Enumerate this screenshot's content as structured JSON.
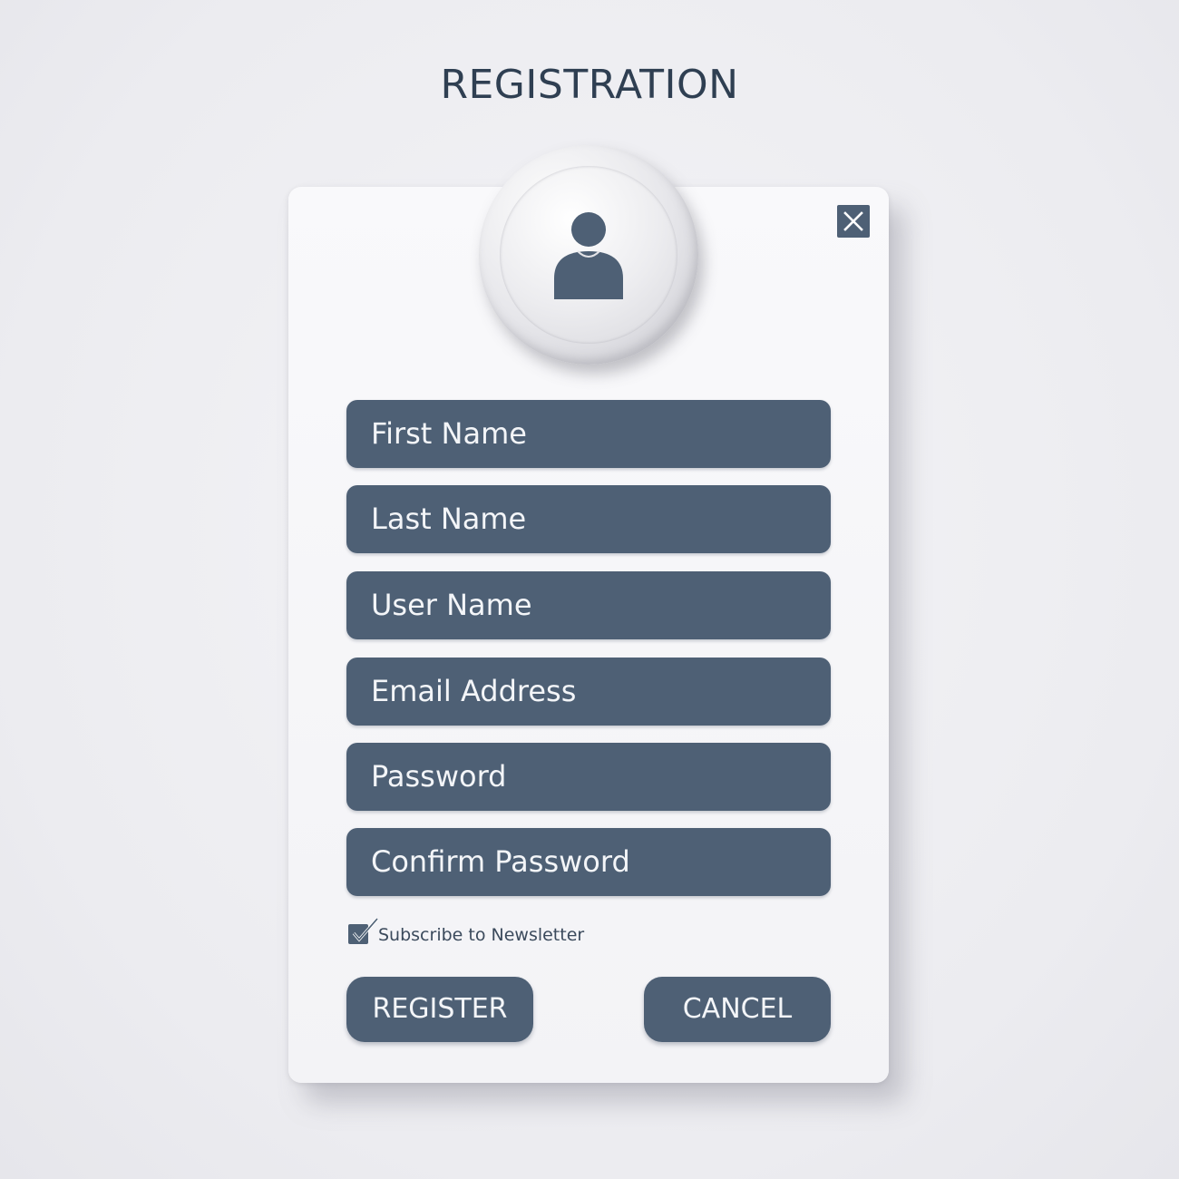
{
  "page": {
    "title": "REGISTRATION"
  },
  "header": {
    "avatar_icon": "user-icon",
    "close_icon": "close-icon"
  },
  "form": {
    "fields": [
      {
        "placeholder": "First Name"
      },
      {
        "placeholder": "Last Name"
      },
      {
        "placeholder": "User Name"
      },
      {
        "placeholder": "Email Address"
      },
      {
        "placeholder": "Password"
      },
      {
        "placeholder": "Confirm Password"
      }
    ],
    "subscribe": {
      "label": "Subscribe to Newsletter",
      "checked": true
    },
    "register_label": "REGISTER",
    "cancel_label": "CANCEL"
  },
  "colors": {
    "accent": "#4e6075",
    "title": "#2f3f52",
    "field_text": "#f3f5f8",
    "background": "#ececf0",
    "card": "#f6f6f8"
  }
}
